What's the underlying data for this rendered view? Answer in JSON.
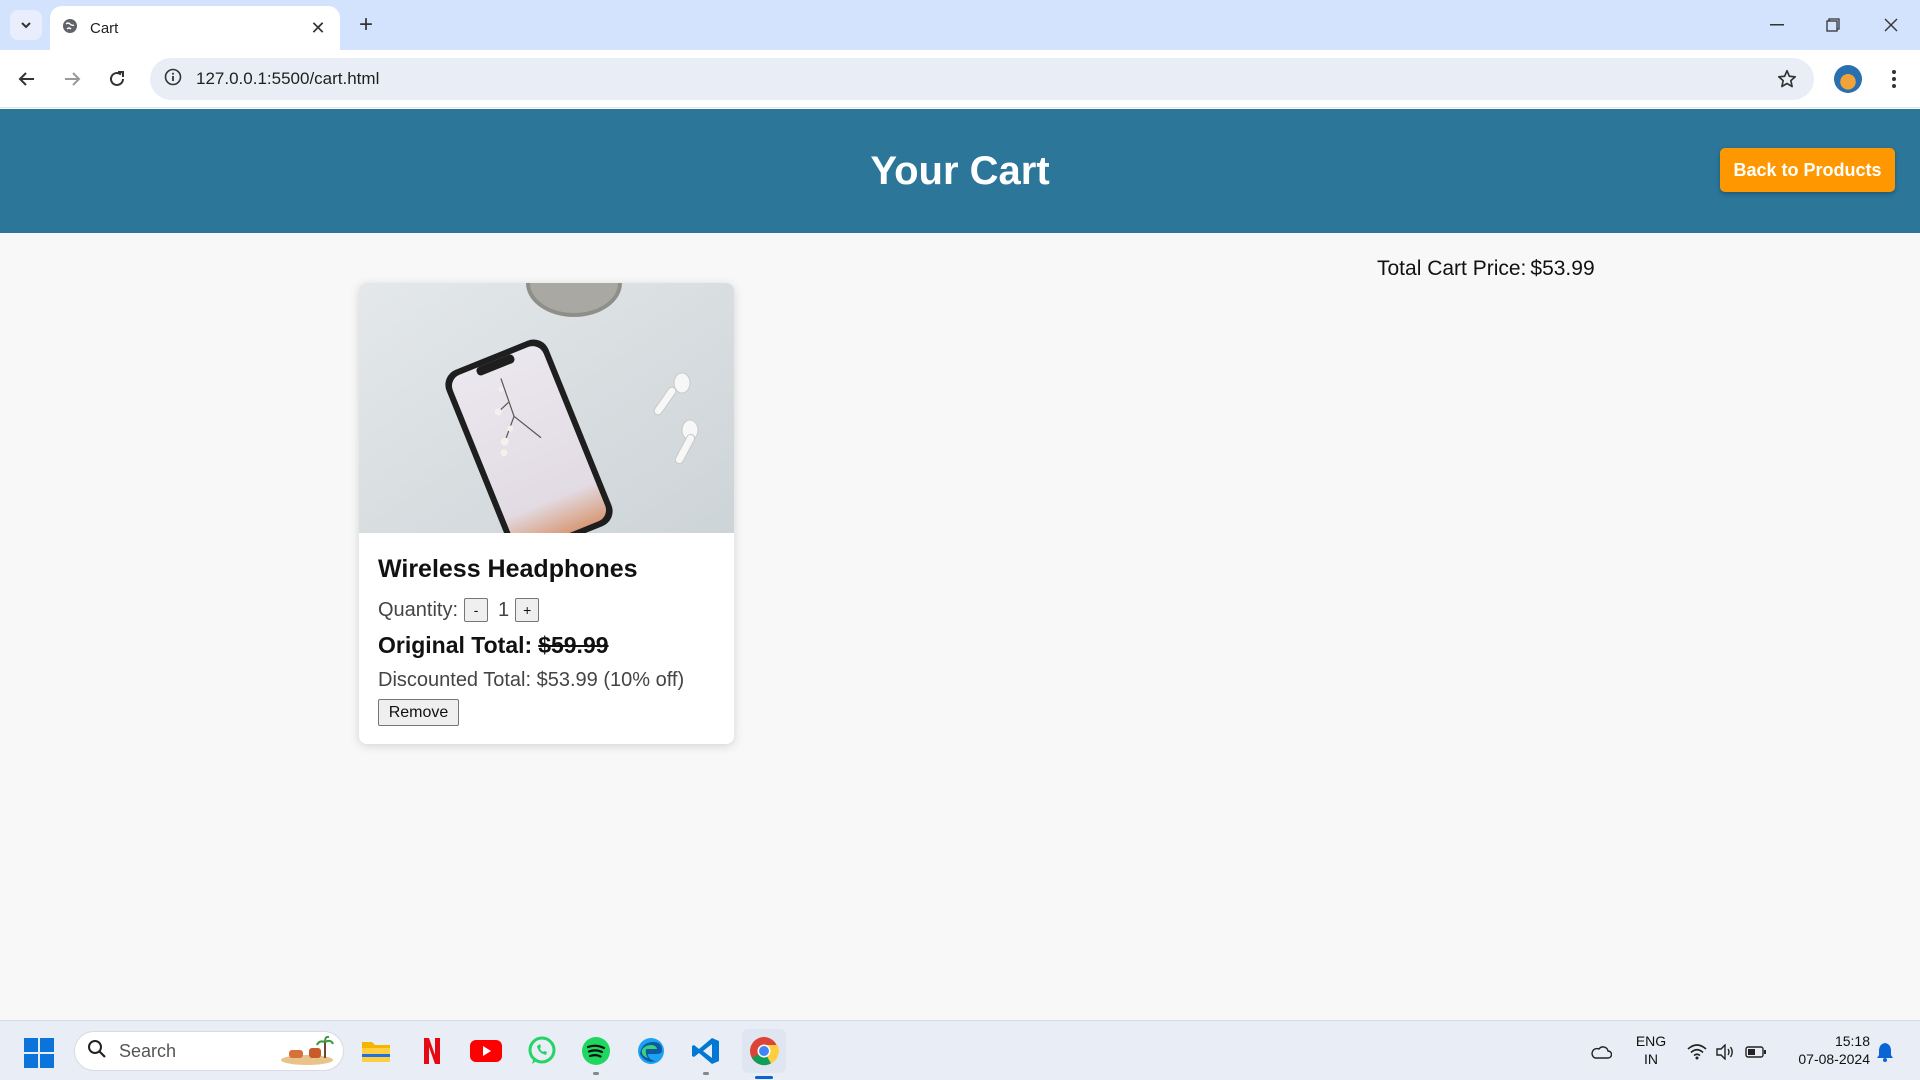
{
  "browser": {
    "tab_title": "Cart",
    "url": "127.0.0.1:5500/cart.html"
  },
  "page": {
    "title": "Your Cart",
    "back_button": "Back to Products",
    "total_label": "Total Cart Price:",
    "total_value": "$53.99"
  },
  "cart_items": [
    {
      "name": "Wireless Headphones",
      "quantity_label": "Quantity:",
      "decrement_label": "-",
      "quantity": "1",
      "increment_label": "+",
      "original_label": "Original Total:",
      "original_price": "$59.99",
      "discounted_text": "Discounted Total: $53.99 (10% off)",
      "remove_label": "Remove"
    }
  ],
  "taskbar": {
    "search_placeholder": "Search",
    "lang_line1": "ENG",
    "lang_line2": "IN",
    "time": "15:18",
    "date": "07-08-2024"
  },
  "colors": {
    "header": "#2b7699",
    "accent_button": "#ff9800",
    "page_background": "#f8f8f8"
  },
  "icons": [
    "tab-search-icon",
    "globe-icon",
    "close-icon",
    "plus-icon",
    "minimize-icon",
    "restore-icon",
    "back-arrow-icon",
    "forward-arrow-icon",
    "reload-icon",
    "site-info-icon",
    "star-icon",
    "profile-avatar",
    "more-menu-icon",
    "windows-start-icon",
    "search-icon",
    "file-explorer-icon",
    "netflix-icon",
    "youtube-icon",
    "whatsapp-icon",
    "spotify-icon",
    "edge-icon",
    "vscode-icon",
    "chrome-icon",
    "onedrive-icon",
    "wifi-icon",
    "volume-icon",
    "battery-icon",
    "notification-bell-icon"
  ]
}
